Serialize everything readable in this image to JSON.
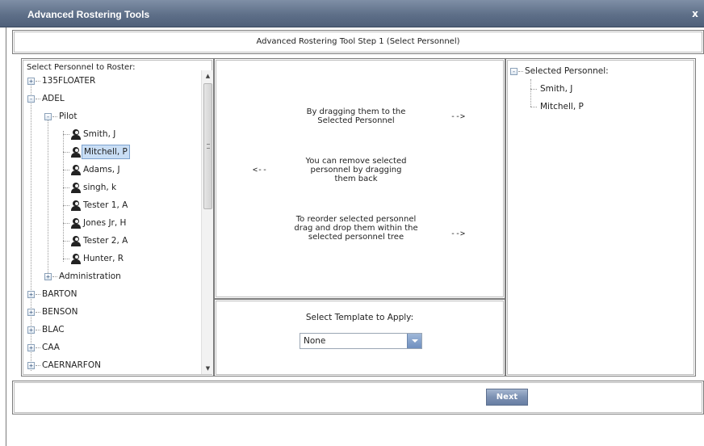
{
  "window": {
    "title": "Advanced Rostering Tools",
    "close_glyph": "x"
  },
  "step": {
    "title": "Advanced Rostering Tool Step 1 (Select Personnel)"
  },
  "personnel_tree": {
    "heading": "Select Personnel to Roster:",
    "nodes": {
      "n135floater": "135FLOATER",
      "adel": "ADEL",
      "pilot": "Pilot",
      "smith": "Smith, J",
      "mitchell": "Mitchell, P",
      "adams": "Adams, J",
      "singh": "singh, k",
      "tester1": "Tester 1, A",
      "jones": "Jones Jr, H",
      "tester2": "Tester 2, A",
      "hunter": "Hunter, R",
      "administration": "Administration",
      "barton": "BARTON",
      "benson": "BENSON",
      "blac": "BLAC",
      "caa": "CAA",
      "caernarfon": "CAERNARFON"
    },
    "expand_glyph": "+",
    "collapse_glyph": "-",
    "scroll_up_glyph": "▲",
    "scroll_down_glyph": "▼"
  },
  "instructions": {
    "drag_to_selected": "By dragging them to the Selected Personnel",
    "drag_to_selected_arrow": "-->",
    "remove_selected": "You can remove selected personnel by dragging them back",
    "remove_selected_arrow": "<--",
    "reorder": "To reorder selected personnel drag and drop them within the selected personnel tree",
    "reorder_arrow": "-->"
  },
  "template": {
    "label": "Select Template to Apply:",
    "selected": "None"
  },
  "selected_personnel": {
    "heading": "Selected Personnel:",
    "items": [
      "Smith, J",
      "Mitchell, P"
    ]
  },
  "footer": {
    "next_label": "Next"
  },
  "colors": {
    "titlebar": "#5e6f88",
    "selection": "#c9def5",
    "next_button": "#7c91b3"
  }
}
